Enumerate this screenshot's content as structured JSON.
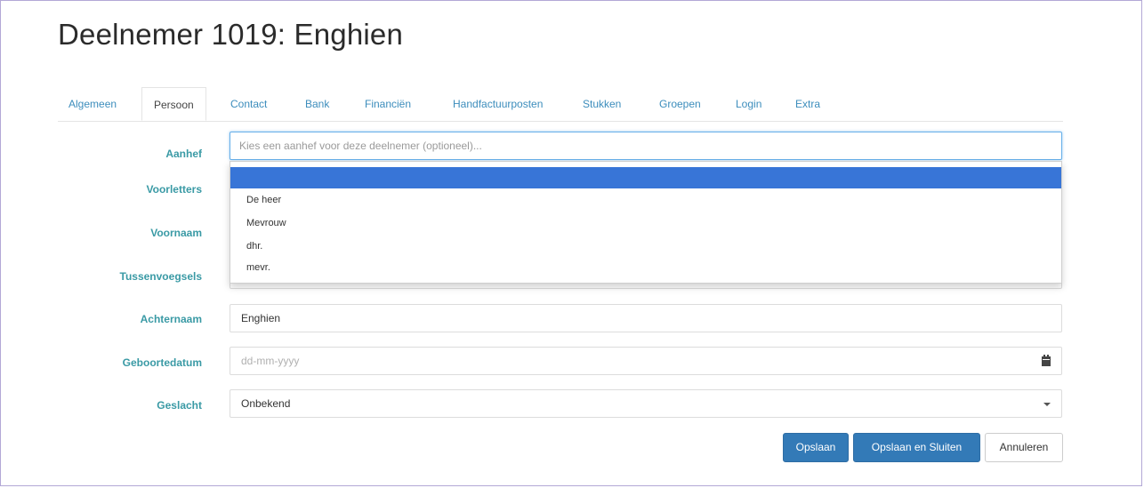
{
  "page": {
    "title": "Deelnemer 1019: Enghien"
  },
  "tabs": [
    {
      "label": "Algemeen",
      "active": false
    },
    {
      "label": "Persoon",
      "active": true
    },
    {
      "label": "Contact",
      "active": false
    },
    {
      "label": "Bank",
      "active": false
    },
    {
      "label": "Financiën",
      "active": false
    },
    {
      "label": "Handfactuurposten",
      "active": false
    },
    {
      "label": "Stukken",
      "active": false
    },
    {
      "label": "Groepen",
      "active": false
    },
    {
      "label": "Login",
      "active": false
    },
    {
      "label": "Extra",
      "active": false
    }
  ],
  "form": {
    "aanhef": {
      "label": "Aanhef",
      "placeholder": "Kies een aanhef voor deze deelnemer (optioneel)...",
      "value": ""
    },
    "voorletters": {
      "label": "Voorletters"
    },
    "voornaam": {
      "label": "Voornaam"
    },
    "tussenvoegsels": {
      "label": "Tussenvoegsels"
    },
    "achternaam": {
      "label": "Achternaam",
      "value": "Enghien"
    },
    "geboortedatum": {
      "label": "Geboortedatum",
      "placeholder": "dd-mm-yyyy",
      "icon": "calendar-icon"
    },
    "geslacht": {
      "label": "Geslacht",
      "value": "Onbekend",
      "icon": "caret-down-icon"
    }
  },
  "dropdown": {
    "options": [
      "",
      "De heer",
      "Mevrouw",
      "dhr.",
      "mevr."
    ],
    "highlighted_index": 0
  },
  "buttons": {
    "save": "Opslaan",
    "save_close": "Opslaan en Sluiten",
    "cancel": "Annuleren"
  },
  "colors": {
    "tab_link": "#3c8dbc",
    "label": "#3a9aa5",
    "primary": "#337ab7",
    "highlight": "#3875d7"
  }
}
